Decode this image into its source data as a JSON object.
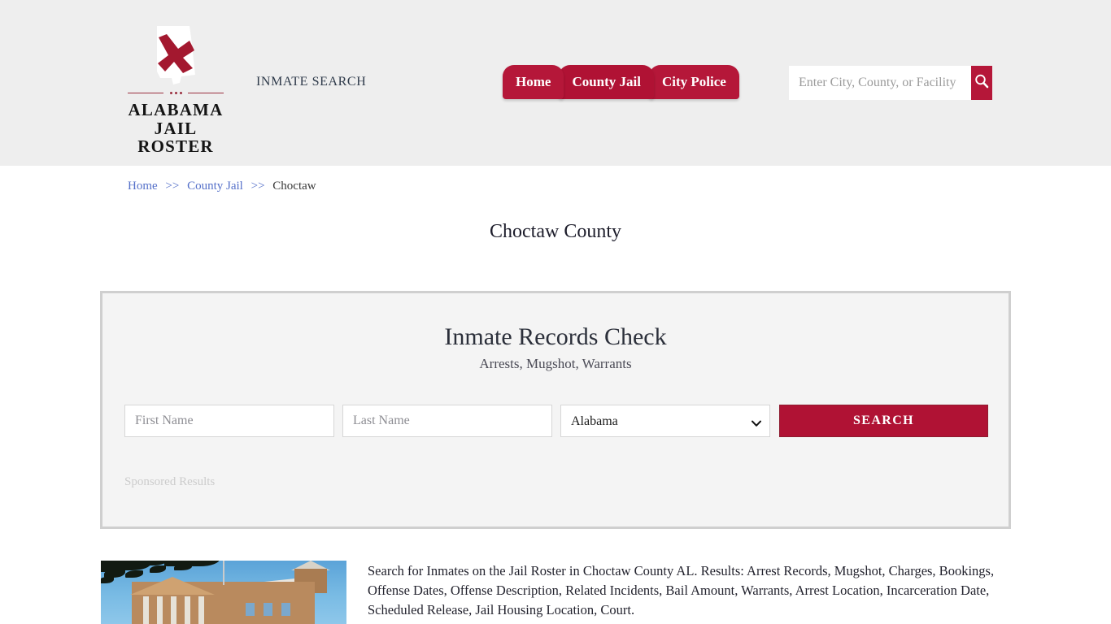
{
  "header": {
    "logo": {
      "line1": "ALABAMA",
      "line2": "JAIL ROSTER",
      "state_icon": "alabama-state-outline-icon",
      "cross_color": "#a3182f"
    },
    "tagline": "INMATE SEARCH",
    "nav": [
      {
        "label": "Home"
      },
      {
        "label": "County Jail"
      },
      {
        "label": "City Police"
      }
    ],
    "search": {
      "placeholder": "Enter City, County, or Facility",
      "value": "",
      "button_icon": "search-icon",
      "button_color": "#b51739"
    },
    "background_color": "#eeeeee"
  },
  "breadcrumb": {
    "items": [
      {
        "label": "Home",
        "link": true
      },
      {
        "label": "County Jail",
        "link": true
      },
      {
        "label": "Choctaw",
        "link": false
      }
    ],
    "separator": ">>",
    "link_color": "#5570c9"
  },
  "page": {
    "title": "Choctaw County"
  },
  "sponsored_panel": {
    "title": "Inmate Records Check",
    "subtitle": "Arrests, Mugshot, Warrants",
    "form": {
      "first_name_placeholder": "First Name",
      "first_name_value": "",
      "last_name_placeholder": "Last Name",
      "last_name_value": "",
      "state_selected": "Alabama",
      "state_options": [
        "Alabama"
      ],
      "chevron_icon": "chevron-down-icon",
      "search_button_label": "SEARCH",
      "search_button_color": "#b01234"
    },
    "sponsored_label": "Sponsored Results"
  },
  "content": {
    "image_alt": "choctaw-county-courthouse-photo",
    "paragraph": "Search for Inmates on the Jail Roster in Choctaw  County AL. Results: Arrest Records, Mugshot, Charges, Bookings, Offense Dates, Offense Description, Related Incidents, Bail Amount, Warrants, Arrest Location, Incarceration Date, Scheduled Release, Jail Housing Location, Court."
  }
}
